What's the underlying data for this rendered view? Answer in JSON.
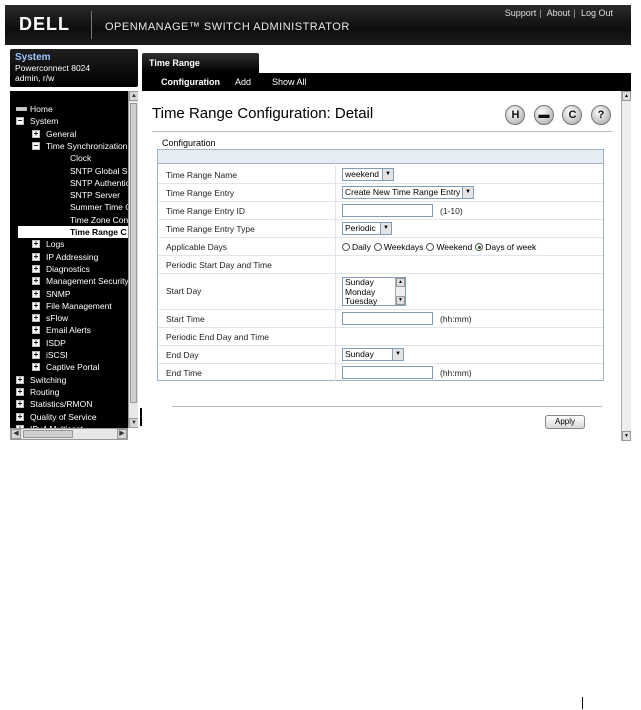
{
  "header": {
    "logo": "DELL",
    "app_title": "OPENMANAGE™ SWITCH ADMINISTRATOR",
    "links": [
      "Support",
      "About",
      "Log Out"
    ]
  },
  "system_box": {
    "title": "System",
    "device": "Powerconnect 8024",
    "user": "admin, r/w"
  },
  "tree": [
    {
      "label": "Home",
      "level": 0,
      "icon": "home-icon"
    },
    {
      "label": "System",
      "level": 0,
      "expander": "minus"
    },
    {
      "label": "General",
      "level": 1,
      "expander": "plus"
    },
    {
      "label": "Time Synchronization",
      "level": 1,
      "expander": "minus"
    },
    {
      "label": "Clock",
      "level": 2
    },
    {
      "label": "SNTP Global Se",
      "level": 2
    },
    {
      "label": "SNTP Authentica",
      "level": 2
    },
    {
      "label": "SNTP Server",
      "level": 2
    },
    {
      "label": "Summer Time C",
      "level": 2
    },
    {
      "label": "Time Zone Confi",
      "level": 2
    },
    {
      "label": "Time Range C",
      "level": 2,
      "selected": true
    },
    {
      "label": "Logs",
      "level": 1,
      "expander": "plus"
    },
    {
      "label": "IP Addressing",
      "level": 1,
      "expander": "plus"
    },
    {
      "label": "Diagnostics",
      "level": 1,
      "expander": "plus"
    },
    {
      "label": "Management Security",
      "level": 1,
      "expander": "plus"
    },
    {
      "label": "SNMP",
      "level": 1,
      "expander": "plus"
    },
    {
      "label": "File Management",
      "level": 1,
      "expander": "plus"
    },
    {
      "label": "sFlow",
      "level": 1,
      "expander": "plus"
    },
    {
      "label": "Email Alerts",
      "level": 1,
      "expander": "plus"
    },
    {
      "label": "ISDP",
      "level": 1,
      "expander": "plus"
    },
    {
      "label": "iSCSI",
      "level": 1,
      "expander": "plus"
    },
    {
      "label": "Captive Portal",
      "level": 1,
      "expander": "plus"
    },
    {
      "label": "Switching",
      "level": 0,
      "expander": "plus"
    },
    {
      "label": "Routing",
      "level": 0,
      "expander": "plus"
    },
    {
      "label": "Statistics/RMON",
      "level": 0,
      "expander": "plus"
    },
    {
      "label": "Quality of Service",
      "level": 0,
      "expander": "plus"
    },
    {
      "label": "IPv4 Multicast",
      "level": 0,
      "expander": "plus"
    }
  ],
  "tab": {
    "label": "Time Range Configuration"
  },
  "subnav": [
    "Configuration",
    "Add",
    "Show All"
  ],
  "page": {
    "title": "Time Range Configuration: Detail",
    "section": "Configuration",
    "toolbar_icons": [
      {
        "name": "save-icon",
        "glyph": "H"
      },
      {
        "name": "print-icon",
        "glyph": "▬"
      },
      {
        "name": "refresh-icon",
        "glyph": "C"
      },
      {
        "name": "help-icon",
        "glyph": "?"
      }
    ]
  },
  "form": {
    "time_range_name": {
      "label": "Time Range Name",
      "value": "weekend"
    },
    "time_range_entry": {
      "label": "Time Range Entry",
      "value": "Create New Time Range Entry"
    },
    "time_range_entry_id": {
      "label": "Time Range Entry ID",
      "value": "",
      "hint": "(1-10)"
    },
    "time_range_entry_type": {
      "label": "Time Range Entry Type",
      "value": "Periodic"
    },
    "applicable_days": {
      "label": "Applicable Days",
      "options": [
        "Daily",
        "Weekdays",
        "Weekend",
        "Days of week"
      ],
      "selected": "Days of week"
    },
    "periodic_start": {
      "label": "Periodic Start Day and Time"
    },
    "start_day": {
      "label": "Start Day",
      "options": [
        "Sunday",
        "Monday",
        "Tuesday"
      ]
    },
    "start_time": {
      "label": "Start Time",
      "value": "",
      "hint": "(hh:mm)"
    },
    "periodic_end": {
      "label": "Periodic End Day and Time"
    },
    "end_day": {
      "label": "End Day",
      "value": "Sunday"
    },
    "end_time": {
      "label": "End Time",
      "value": "",
      "hint": "(hh:mm)"
    }
  },
  "apply_label": "Apply"
}
